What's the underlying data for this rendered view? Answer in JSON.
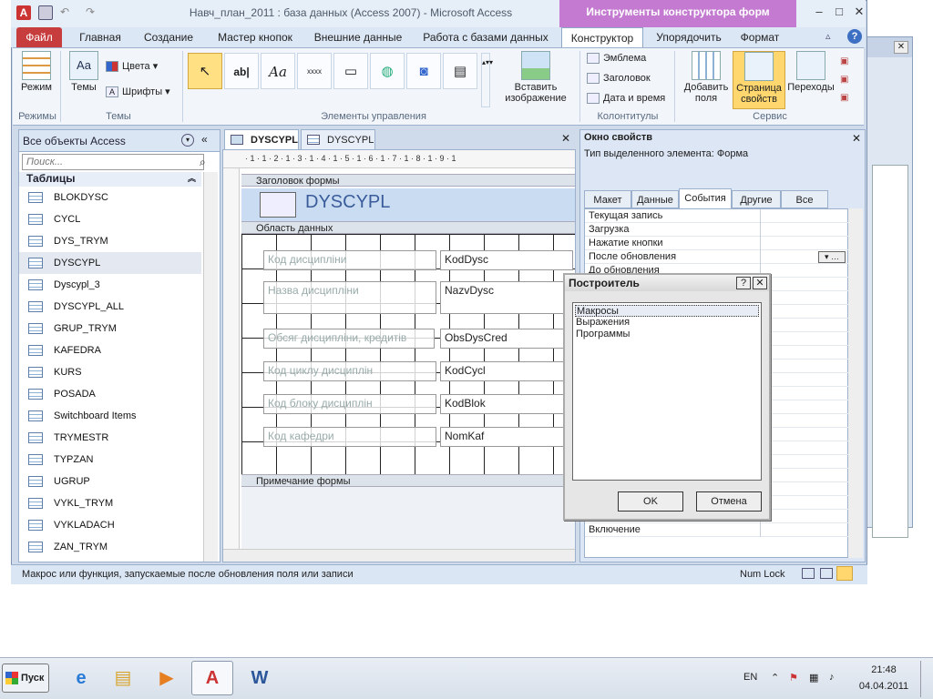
{
  "window": {
    "title": "Навч_план_2011 : база данных (Access 2007)  -  Microsoft Access",
    "context_title": "Инструменты конструктора форм",
    "buttons": {
      "min": "–",
      "max": "□",
      "close": "✕"
    }
  },
  "ribbon_tabs": [
    "Файл",
    "Главная",
    "Создание",
    "Мастер кнопок",
    "Внешние данные",
    "Работа с базами данных",
    "Конструктор",
    "Упорядочить",
    "Формат"
  ],
  "ribbon": {
    "mode_label": "Режим",
    "modes_group": "Режимы",
    "themes_label": "Темы",
    "colors_label": "Цвета",
    "fonts_label": "Шрифты",
    "themes_group": "Темы",
    "controls_group": "Элементы управления",
    "insert_image_label": "Вставить изображение",
    "logo_label": "Эмблема",
    "title_label": "Заголовок",
    "datetime_label": "Дата и время",
    "headers_group": "Колонтитулы",
    "add_fields_label": "Добавить поля",
    "property_sheet_label": "Страница свойств",
    "tab_order_label": "Переходы",
    "tools_group": "Сервис"
  },
  "nav": {
    "title": "Все объекты Access",
    "search_placeholder": "Поиск...",
    "section": "Таблицы",
    "items": [
      "BLOKDYSC",
      "CYCL",
      "DYS_TRYM",
      "DYSCYPL",
      "Dyscypl_3",
      "DYSCYPL_ALL",
      "GRUP_TRYM",
      "KAFEDRA",
      "KURS",
      "POSADA",
      "Switchboard Items",
      "TRYMESTR",
      "TYPZAN",
      "UGRUP",
      "VYKL_TRYM",
      "VYKLADACH",
      "ZAN_TRYM"
    ],
    "selected": "DYSCYPL"
  },
  "doc_tabs": [
    "DYSCYPL",
    "DYSCYPL"
  ],
  "form": {
    "ruler": "· 1 · 1 · 2 · 1 · 3 · 1 · 4 · 1 · 5 · 1 · 6 · 1 · 7 · 1 · 8 · 1 · 9 · 1",
    "header_section": "Заголовок формы",
    "title": "DYSCYPL",
    "detail_section": "Область данных",
    "footer_section": "Примечание формы",
    "rows": [
      {
        "label": "Код дисципліни",
        "field": "KodDysc"
      },
      {
        "label": "Назва дисципліни",
        "field": "NazvDysc"
      },
      {
        "label": "Обсяг дисципліни, кредитів",
        "field": "ObsDysCred"
      },
      {
        "label": "Код циклу дисциплін",
        "field": "KodCycl"
      },
      {
        "label": "Код блоку дисциплін",
        "field": "KodBlok"
      },
      {
        "label": "Код кафедри",
        "field": "NomKaf"
      }
    ]
  },
  "props": {
    "title": "Окно свойств",
    "type_text": "Тип выделенного элемента:  Форма",
    "tabs": [
      "Макет",
      "Данные",
      "События",
      "Другие",
      "Все"
    ],
    "active_tab": "События",
    "rows": [
      "Текущая запись",
      "Загрузка",
      "Нажатие кнопки",
      "После обновления",
      "До обновления",
      "",
      "",
      "",
      "",
      "",
      "",
      "",
      "",
      "",
      "",
      "",
      "",
      "",
      "",
      "",
      "",
      "Закрытие",
      "Изменение размера",
      "Включение"
    ]
  },
  "dialog": {
    "title": "Построитель",
    "items": [
      "Макросы",
      "Выражения",
      "Программы"
    ],
    "selected": "Макросы",
    "ok": "OK",
    "cancel": "Отмена",
    "help": "?",
    "close": "✕"
  },
  "status": {
    "text": "Макрос или функция, запускаемые после обновления поля или записи",
    "numlock": "Num Lock"
  },
  "taskbar": {
    "start": "Пуск",
    "lang": "EN",
    "time": "21:48",
    "date": "04.04.2011"
  },
  "colors": {
    "file_tab": "#c73d3d",
    "context": "#c37ad0",
    "accent": "#3b5c9b"
  }
}
